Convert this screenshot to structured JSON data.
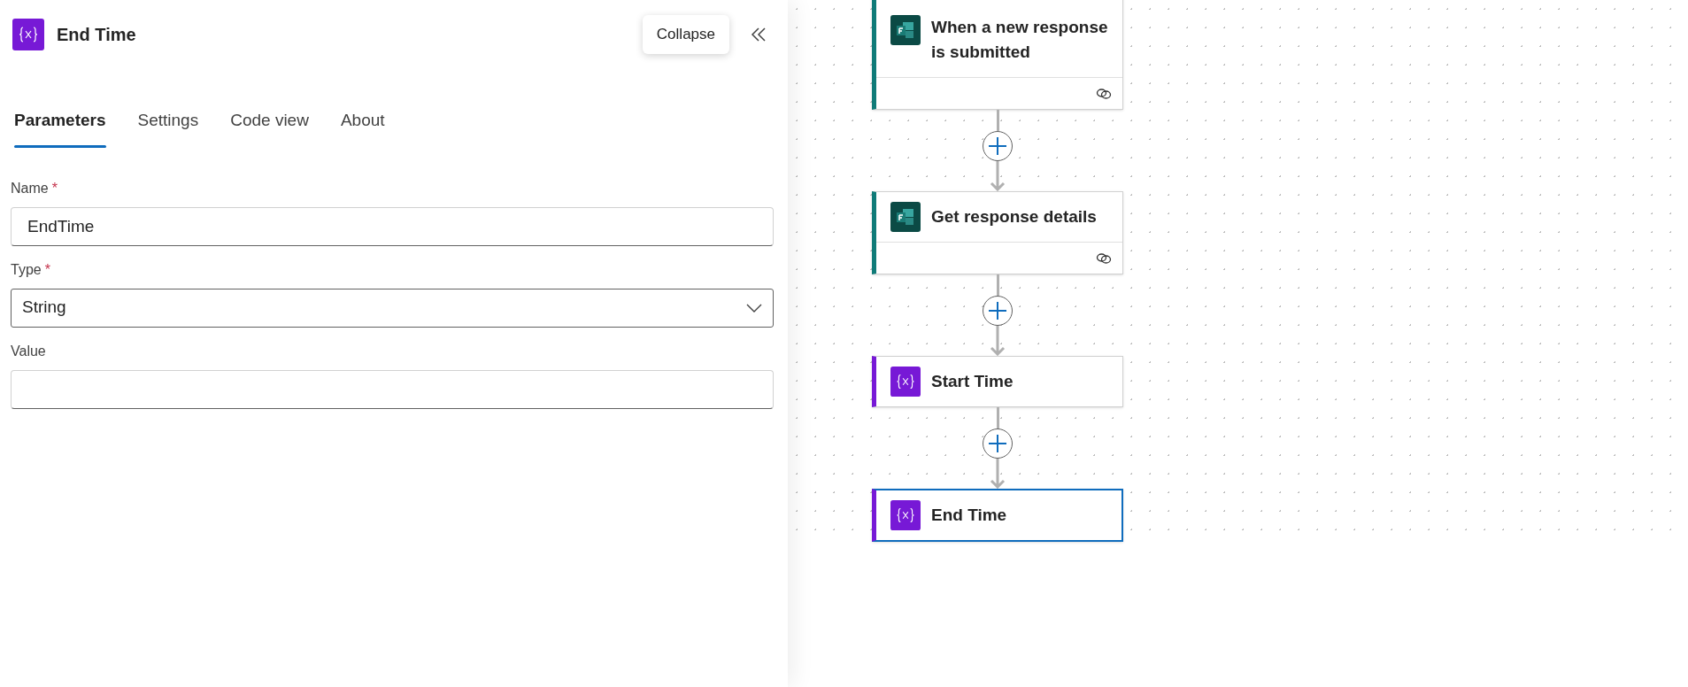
{
  "panel": {
    "title": "End Time",
    "collapse_tooltip": "Collapse",
    "required_mark": "*",
    "tabs": [
      {
        "label": "Parameters",
        "selected": true
      },
      {
        "label": "Settings",
        "selected": false
      },
      {
        "label": "Code view",
        "selected": false
      },
      {
        "label": "About",
        "selected": false
      }
    ],
    "fields": [
      {
        "kind": "text",
        "label": "Name",
        "required": true,
        "value": "EndTime"
      },
      {
        "kind": "dropdown",
        "label": "Type",
        "required": true,
        "value": "String"
      },
      {
        "kind": "text",
        "label": "Value",
        "required": false
      }
    ]
  },
  "flow": {
    "nodes": [
      {
        "kind": "forms",
        "title": "When a new response is submitted",
        "selected": false
      },
      {
        "kind": "forms",
        "title": "Get response details",
        "selected": false
      },
      {
        "kind": "variable",
        "title": "Start Time",
        "selected": false
      },
      {
        "kind": "variable",
        "title": "End Time",
        "selected": true
      }
    ]
  }
}
